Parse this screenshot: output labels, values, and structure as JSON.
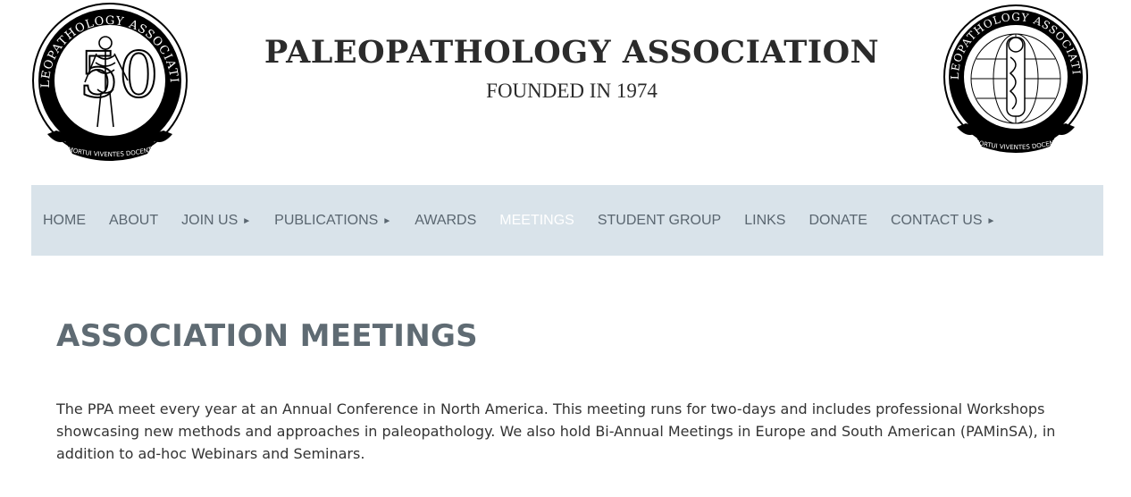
{
  "header": {
    "title": "PALEOPATHOLOGY ASSOCIATION",
    "subtitle": "FOUNDED IN 1974",
    "logo_left": {
      "icon": "skeleton-seal-50-logo",
      "ring_text": "PALEOPATHOLOGY ASSOCIATION",
      "numeral": "50",
      "motto": "MORTUI VIVENTES DOCENT"
    },
    "logo_right": {
      "icon": "mummy-globe-seal-logo",
      "ring_text": "PALEOPATHOLOGY ASSOCIATION",
      "motto": "MORTUI VIVENTES DOCENT"
    }
  },
  "nav": {
    "background": "#d9e3ea",
    "items": [
      {
        "label": "HOME",
        "submenu_icon": ""
      },
      {
        "label": "ABOUT",
        "submenu_icon": ""
      },
      {
        "label": "JOIN US",
        "submenu_icon": "►"
      },
      {
        "label": "PUBLICATIONS",
        "submenu_icon": "►"
      },
      {
        "label": "AWARDS",
        "submenu_icon": ""
      },
      {
        "label": "MEETINGS",
        "submenu_icon": ""
      },
      {
        "label": "STUDENT GROUP",
        "submenu_icon": ""
      },
      {
        "label": "LINKS",
        "submenu_icon": ""
      },
      {
        "label": "DONATE",
        "submenu_icon": ""
      },
      {
        "label": "CONTACT US",
        "submenu_icon": "►"
      }
    ],
    "active_label": "MEETINGS"
  },
  "main": {
    "heading": "ASSOCIATION MEETINGS",
    "body": "The PPA meet every year at an Annual Conference in North America. This meeting runs for two-days and includes professional Workshops showcasing new methods and approaches in paleopathology. We also hold Bi-Annual Meetings in Europe and South American (PAMinSA), in addition to ad-hoc Webinars and Seminars."
  }
}
